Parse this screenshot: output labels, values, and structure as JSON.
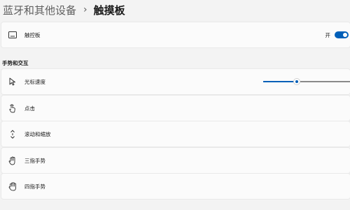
{
  "breadcrumb": {
    "parent": "蓝牙和其他设备",
    "separator": "›",
    "current": "触摸板"
  },
  "touchpad": {
    "label": "触控板",
    "icon": "touchpad-icon",
    "toggle_state_label": "开",
    "toggle_on": true
  },
  "gestures_section": {
    "title": "手势和交互",
    "items": [
      {
        "label": "光标速度",
        "icon": "cursor-icon"
      },
      {
        "label": "点击",
        "icon": "tap-icon"
      },
      {
        "label": "滚动和缩放",
        "icon": "scroll-zoom-icon"
      },
      {
        "label": "三指手势",
        "icon": "three-finger-icon"
      },
      {
        "label": "四指手势",
        "icon": "four-finger-icon"
      }
    ]
  },
  "cursor_speed": {
    "value_fraction": 0.38
  },
  "colors": {
    "accent": "#005fb8",
    "background": "#f3f3f3",
    "card": "#fbfbfb"
  }
}
